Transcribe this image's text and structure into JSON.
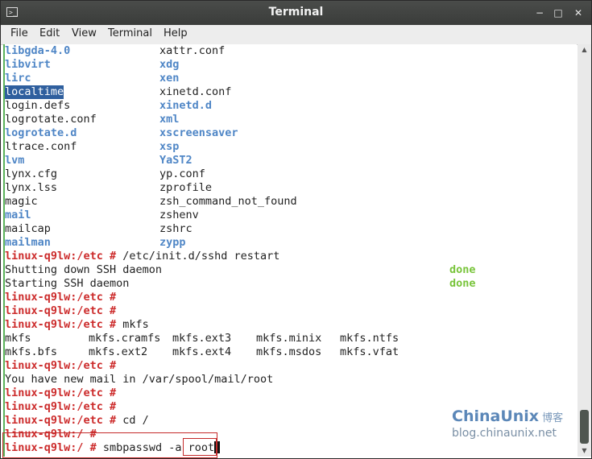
{
  "window": {
    "title": "Terminal",
    "icon": "terminal-icon",
    "min": "−",
    "max": "□",
    "close": "✕"
  },
  "menu": [
    "File",
    "Edit",
    "View",
    "Terminal",
    "Help"
  ],
  "colors": {
    "dir": "#4f86c6",
    "prompt": "#cc2b2b",
    "done": "#78c43a",
    "selection": "#2f5f9e"
  },
  "terminal": {
    "listing": [
      {
        "a": "libgda-4.0",
        "a_dir": true,
        "b": "xattr.conf",
        "b_dir": false
      },
      {
        "a": "libvirt",
        "a_dir": true,
        "b": "xdg",
        "b_dir": true
      },
      {
        "a": "lirc",
        "a_dir": true,
        "b": "xen",
        "b_dir": true
      },
      {
        "a": "localtime",
        "a_sel": true,
        "b": "xinetd.conf",
        "b_dir": false
      },
      {
        "a": "login.defs",
        "a_dir": false,
        "b": "xinetd.d",
        "b_dir": true
      },
      {
        "a": "logrotate.conf",
        "a_dir": false,
        "b": "xml",
        "b_dir": true
      },
      {
        "a": "logrotate.d",
        "a_dir": true,
        "b": "xscreensaver",
        "b_dir": true
      },
      {
        "a": "ltrace.conf",
        "a_dir": false,
        "b": "xsp",
        "b_dir": true
      },
      {
        "a": "lvm",
        "a_dir": true,
        "b": "YaST2",
        "b_dir": true
      },
      {
        "a": "lynx.cfg",
        "a_dir": false,
        "b": "yp.conf",
        "b_dir": false
      },
      {
        "a": "lynx.lss",
        "a_dir": false,
        "b": "zprofile",
        "b_dir": false
      },
      {
        "a": "magic",
        "a_dir": false,
        "b": "zsh_command_not_found",
        "b_dir": false
      },
      {
        "a": "mail",
        "a_dir": true,
        "b": "zshenv",
        "b_dir": false
      },
      {
        "a": "mailcap",
        "a_dir": false,
        "b": "zshrc",
        "b_dir": false
      },
      {
        "a": "mailman",
        "a_dir": true,
        "b": "zypp",
        "b_dir": true
      }
    ],
    "prompt_etc": "linux-q9lw:/etc #",
    "prompt_root": "linux-q9lw:/ #",
    "cmd_restart": " /etc/init.d/sshd restart",
    "shutdown_msg": "Shutting down SSH daemon",
    "start_msg": "Starting SSH daemon",
    "done": "done",
    "cmd_mkfs": " mkfs",
    "mkfs_row1": [
      "mkfs",
      "mkfs.cramfs",
      "mkfs.ext3",
      "mkfs.minix",
      "mkfs.ntfs"
    ],
    "mkfs_row2": [
      "mkfs.bfs",
      "mkfs.ext2",
      "mkfs.ext4",
      "mkfs.msdos",
      "mkfs.vfat"
    ],
    "mail_msg": "You have new mail in /var/spool/mail/root",
    "cmd_cd": " cd /",
    "cmd_smb": " smbpasswd -a ",
    "smb_arg": "root"
  },
  "watermark": {
    "logo": "ChinaUnix",
    "cn": "博客",
    "url": "blog.chinaunix.net"
  }
}
